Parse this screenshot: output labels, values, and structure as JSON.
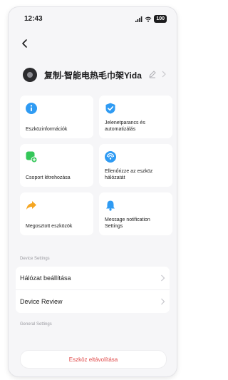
{
  "status_bar": {
    "time": "12:43",
    "battery": "100"
  },
  "device": {
    "name": "复制-智能电热毛巾架Yida"
  },
  "tiles": [
    {
      "label": "Eszközinformációk",
      "icon": "info-icon",
      "color": "#2f9bf3"
    },
    {
      "label": "Jelenetparancs és automatizálás",
      "icon": "automation-icon",
      "color": "#2f9bf3"
    },
    {
      "label": "Csoport létrehozása",
      "icon": "group-add-icon",
      "color": "#34c759"
    },
    {
      "label": "Ellenőrizze az eszköz hálózatát",
      "icon": "network-check-icon",
      "color": "#2f9bf3"
    },
    {
      "label": "Megosztott eszközök",
      "icon": "share-icon",
      "color": "#f5a623"
    },
    {
      "label": "Message notification Settings",
      "icon": "bell-icon",
      "color": "#2f9bf3"
    }
  ],
  "device_settings": {
    "title": "Device Settings",
    "items": [
      {
        "label": "Hálózat beállítása"
      },
      {
        "label": "Device Review"
      }
    ]
  },
  "general_settings": {
    "title": "General Settings"
  },
  "remove_button": {
    "label": "Eszköz eltávolítása"
  }
}
